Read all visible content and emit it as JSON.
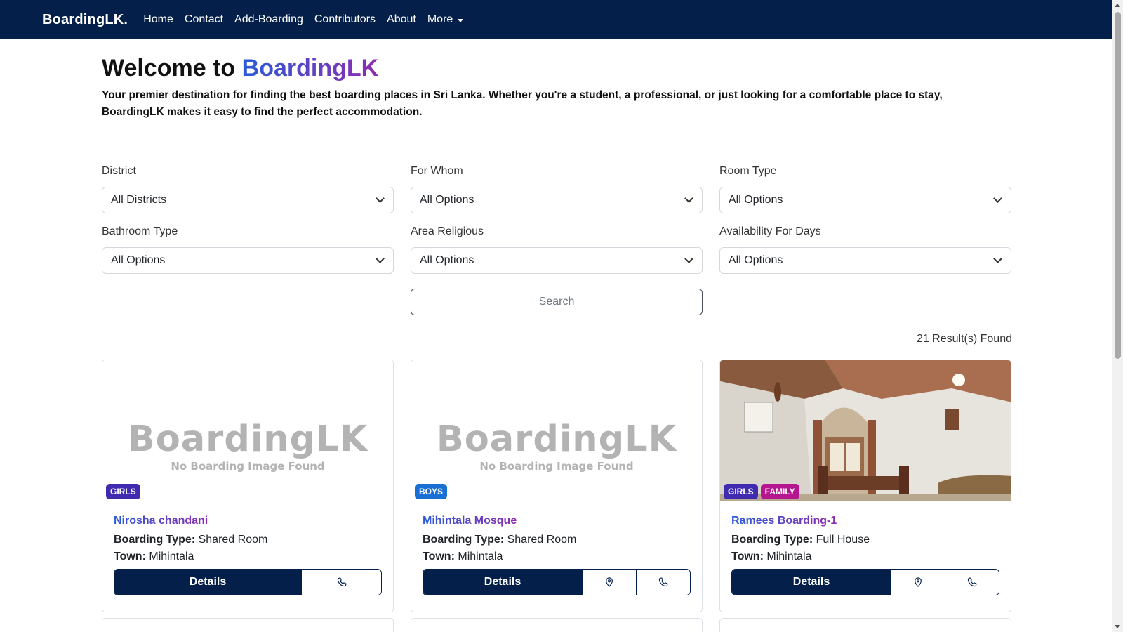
{
  "nav": {
    "brand": "BoardingLK.",
    "links": [
      "Home",
      "Contact",
      "Add-Boarding",
      "Contributors",
      "About"
    ],
    "more": "More"
  },
  "hero": {
    "title_prefix": "Welcome to ",
    "title_brand": "BoardingLK",
    "description": "Your premier destination for finding the best boarding places in Sri Lanka. Whether you're a student, a professional, or just looking for a comfortable place to stay, BoardingLK makes it easy to find the perfect accommodation."
  },
  "filters": [
    {
      "label": "District",
      "value": "All Districts"
    },
    {
      "label": "For Whom",
      "value": "All Options"
    },
    {
      "label": "Room Type",
      "value": "All Options"
    },
    {
      "label": "Bathroom Type",
      "value": "All Options"
    },
    {
      "label": "Area Religious",
      "value": "All Options"
    },
    {
      "label": "Availability For Days",
      "value": "All Options"
    }
  ],
  "search_label": "Search",
  "result_count": "21 Result(s) Found",
  "labels": {
    "boarding_type": "Boarding Type:",
    "town": "Town:",
    "details": "Details"
  },
  "placeholder_image": {
    "brand": "BoardingLK",
    "sub": "No Boarding Image Found"
  },
  "listings": [
    {
      "title": "Nirosha chandani",
      "boarding_type": "Shared Room",
      "town": "Mihintala",
      "badges": [
        "GIRLS"
      ]
    },
    {
      "title": "Mihintala Mosque",
      "boarding_type": "Shared Room",
      "town": "Mihintala",
      "badges": [
        "BOYS"
      ]
    },
    {
      "title": "Ramees Boarding-1",
      "boarding_type": "Full House",
      "town": "Mihintala",
      "badges": [
        "GIRLS",
        "FAMILY"
      ]
    }
  ],
  "colors": {
    "navbar": "#04204a",
    "accent_gradient_start": "#2a5bd7",
    "accent_gradient_end": "#8e2bb0",
    "badge_girls": "#3f2ab0",
    "badge_boys": "#1a6fd4",
    "badge_family": "#b5168f"
  }
}
